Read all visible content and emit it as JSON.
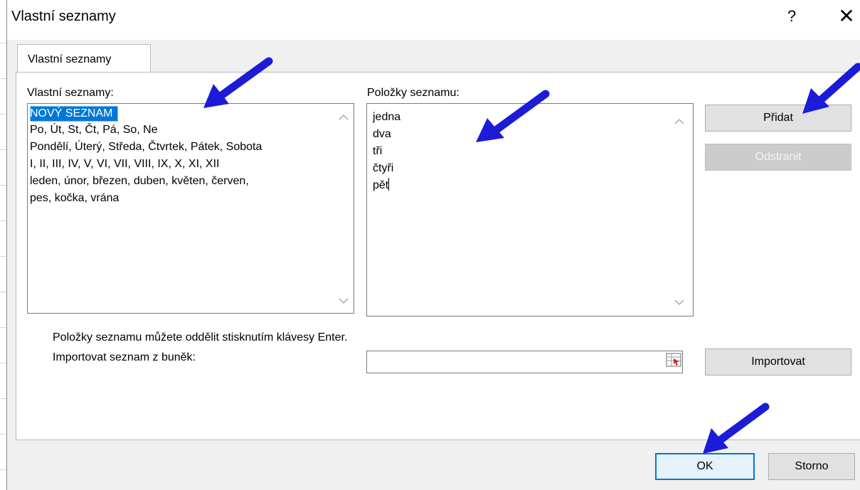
{
  "window": {
    "title": "Vlastní seznamy",
    "help_label": "?",
    "close_label": "✕"
  },
  "tab": {
    "label": "Vlastní seznamy"
  },
  "lists_panel": {
    "label": "Vlastní seznamy:",
    "items": [
      "NOVÝ SEZNAM",
      "Po, Út, St, Čt, Pá, So, Ne",
      "Pondělí, Úterý, Středa, Čtvrtek, Pátek, Sobota",
      "I, II, III, IV, V, VI, VII, VIII, IX, X, XI, XII",
      "leden, únor, březen, duben, květen, červen,",
      "pes, kočka, vrána"
    ],
    "selected_index": 0
  },
  "entries_panel": {
    "label": "Položky seznamu:",
    "lines": [
      "jedna",
      "dva",
      "tři",
      "čtyři",
      "pět"
    ]
  },
  "buttons": {
    "add": "Přidat",
    "remove": "Odstranit",
    "import": "Importovat",
    "ok": "OK",
    "cancel": "Storno"
  },
  "hint": "Položky seznamu můžete oddělit stisknutím klávesy Enter.",
  "import_label": "Importovat seznam z buněk:",
  "import_value": "",
  "colors": {
    "selection": "#0078d7",
    "annotation_arrow": "#1b1bd8"
  },
  "icons": {
    "scroll_up": "chevron-up-icon",
    "scroll_down": "chevron-down-icon",
    "range_select": "range-select-icon",
    "annotation": "arrow-icon"
  }
}
